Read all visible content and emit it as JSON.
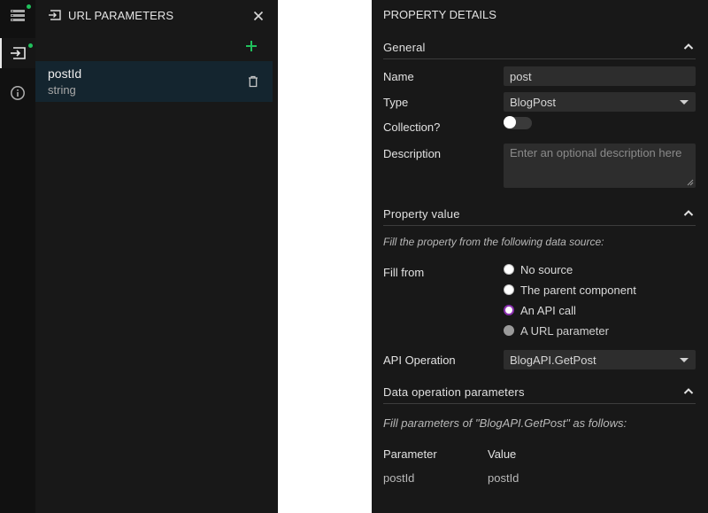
{
  "colors": {
    "accent_green": "#20c05c",
    "selected_item_bg": "#14252f",
    "radio_selected": "#8a2fb0",
    "panel_bg": "#181818",
    "rail_bg": "#111111"
  },
  "rail": {
    "items": [
      {
        "icon": "layers-icon",
        "has_dot": true
      },
      {
        "icon": "url-parameter-icon",
        "has_dot": true,
        "active": true
      },
      {
        "icon": "info-icon",
        "has_dot": false
      }
    ]
  },
  "url_parameters": {
    "title": "URL PARAMETERS",
    "items": [
      {
        "name": "postId",
        "type": "string"
      }
    ]
  },
  "property_details": {
    "title": "PROPERTY DETAILS",
    "general": {
      "heading": "General",
      "name_label": "Name",
      "name_value": "post",
      "type_label": "Type",
      "type_value": "BlogPost",
      "collection_label": "Collection?",
      "collection_on": false,
      "description_label": "Description",
      "description_placeholder": "Enter an optional description here"
    },
    "property_value": {
      "heading": "Property value",
      "hint": "Fill the property from the following data source:",
      "fill_from_label": "Fill from",
      "options": [
        {
          "label": "No source",
          "state": "unselected"
        },
        {
          "label": "The parent component",
          "state": "unselected"
        },
        {
          "label": "An API call",
          "state": "selected"
        },
        {
          "label": "A URL parameter",
          "state": "disabled"
        }
      ],
      "api_operation_label": "API Operation",
      "api_operation_value": "BlogAPI.GetPost"
    },
    "data_operation_parameters": {
      "heading": "Data operation parameters",
      "hint": "Fill parameters of \"BlogAPI.GetPost\" as follows:",
      "columns": [
        "Parameter",
        "Value"
      ],
      "rows": [
        {
          "parameter": "postId",
          "value": "postId"
        }
      ]
    }
  }
}
